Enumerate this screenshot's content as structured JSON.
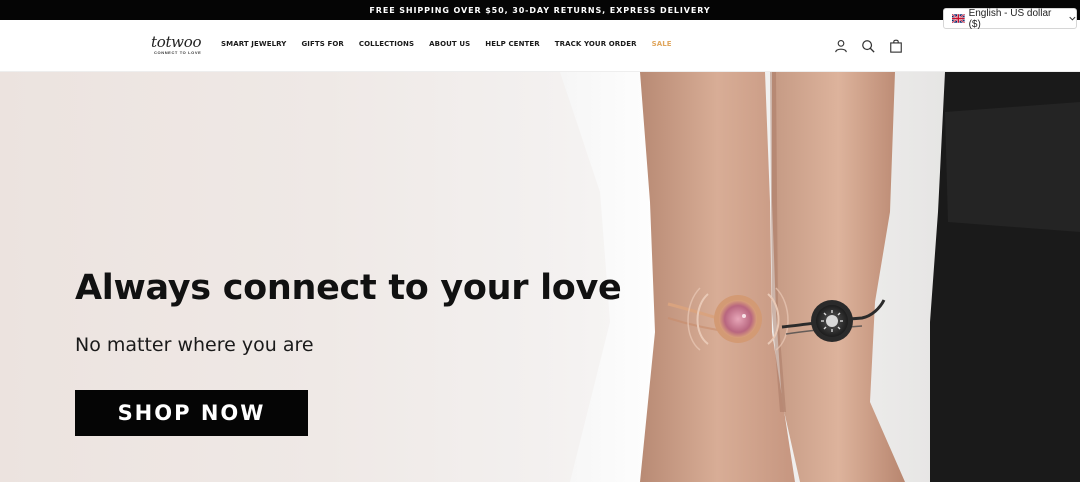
{
  "announcement": "FREE SHIPPING OVER $50, 30-DAY RETURNS, EXPRESS DELIVERY",
  "language_selector": {
    "label": "English - US dollar ($)"
  },
  "logo": {
    "wordmark": "totwoo",
    "tagline": "CONNECT TO LOVE"
  },
  "nav": {
    "items": [
      "SMART JEWELRY",
      "GIFTS FOR",
      "COLLECTIONS",
      "ABOUT US",
      "HELP CENTER",
      "TRACK YOUR ORDER",
      "SALE"
    ]
  },
  "header_icons": [
    "account-icon",
    "search-icon",
    "cart-icon"
  ],
  "hero": {
    "title": "Always connect to your love",
    "subtitle": "No matter where you are",
    "cta": "SHOP NOW"
  },
  "colors": {
    "announcement_bg": "#050505",
    "sale": "#e0a75e",
    "cta_bg": "#050505"
  }
}
